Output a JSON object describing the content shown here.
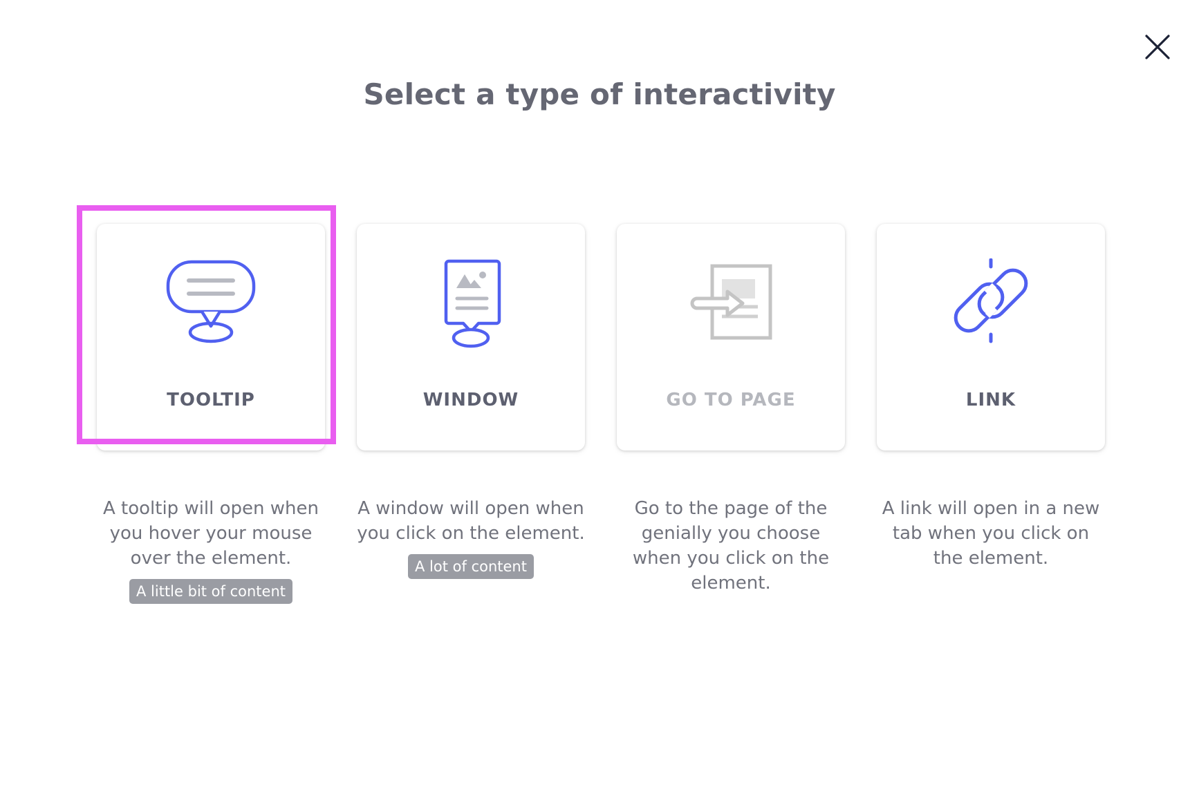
{
  "dialog": {
    "title": "Select a type of interactivity",
    "close_icon": "close-icon"
  },
  "colors": {
    "accent": "#5060f0",
    "disabled_icon": "#c4c4c4",
    "title_text": "#656773",
    "badge_bg": "#9a9ca3",
    "highlight": "#e95ef0"
  },
  "options": [
    {
      "label": "TOOLTIP",
      "icon": "tooltip-icon",
      "description": "A tooltip will open when you hover your mouse over the element.",
      "badge": "A little bit of content",
      "selected": true
    },
    {
      "label": "WINDOW",
      "icon": "window-icon",
      "description": "A window will open when you click on the element.",
      "badge": "A lot of content"
    },
    {
      "label": "GO TO PAGE",
      "icon": "go-to-page-icon",
      "description": "Go to the page of the genially you choose when you click on the element.",
      "disabled": true
    },
    {
      "label": "LINK",
      "icon": "link-icon",
      "description": "A link will open in a new tab when you click on the element."
    }
  ]
}
